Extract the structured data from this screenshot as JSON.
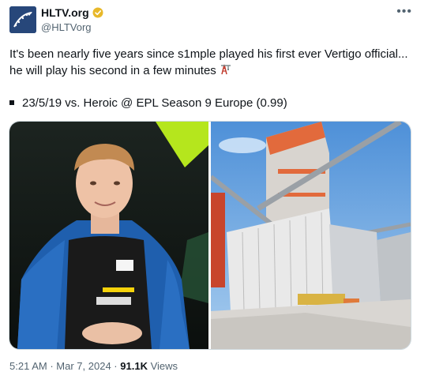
{
  "author": {
    "display_name": "HLTV.org",
    "handle": "@HLTVorg",
    "verified_badge_icon": "verified-gold-badge"
  },
  "tweet": {
    "text_line1": "It's been nearly five years since s1mple played his first ever Vertigo official... he will play his second in a few minutes",
    "emoji_icon": "crane-pylon-emoji",
    "text_line2": "23/5/19 vs. Heroic @ EPL Season 9 Europe (0.99)"
  },
  "media": {
    "left_image": "player-draped-in-flag-photo",
    "right_image": "vertigo-map-skyscraper-screenshot"
  },
  "meta": {
    "time": "5:21 AM",
    "separator": "·",
    "date": "Mar 7, 2024",
    "views_count": "91.1K",
    "views_label": "Views"
  },
  "colors": {
    "text": "#0f1419",
    "secondary": "#536471",
    "verified_gold": "#e8b829",
    "avatar_bg": "#27477a"
  }
}
